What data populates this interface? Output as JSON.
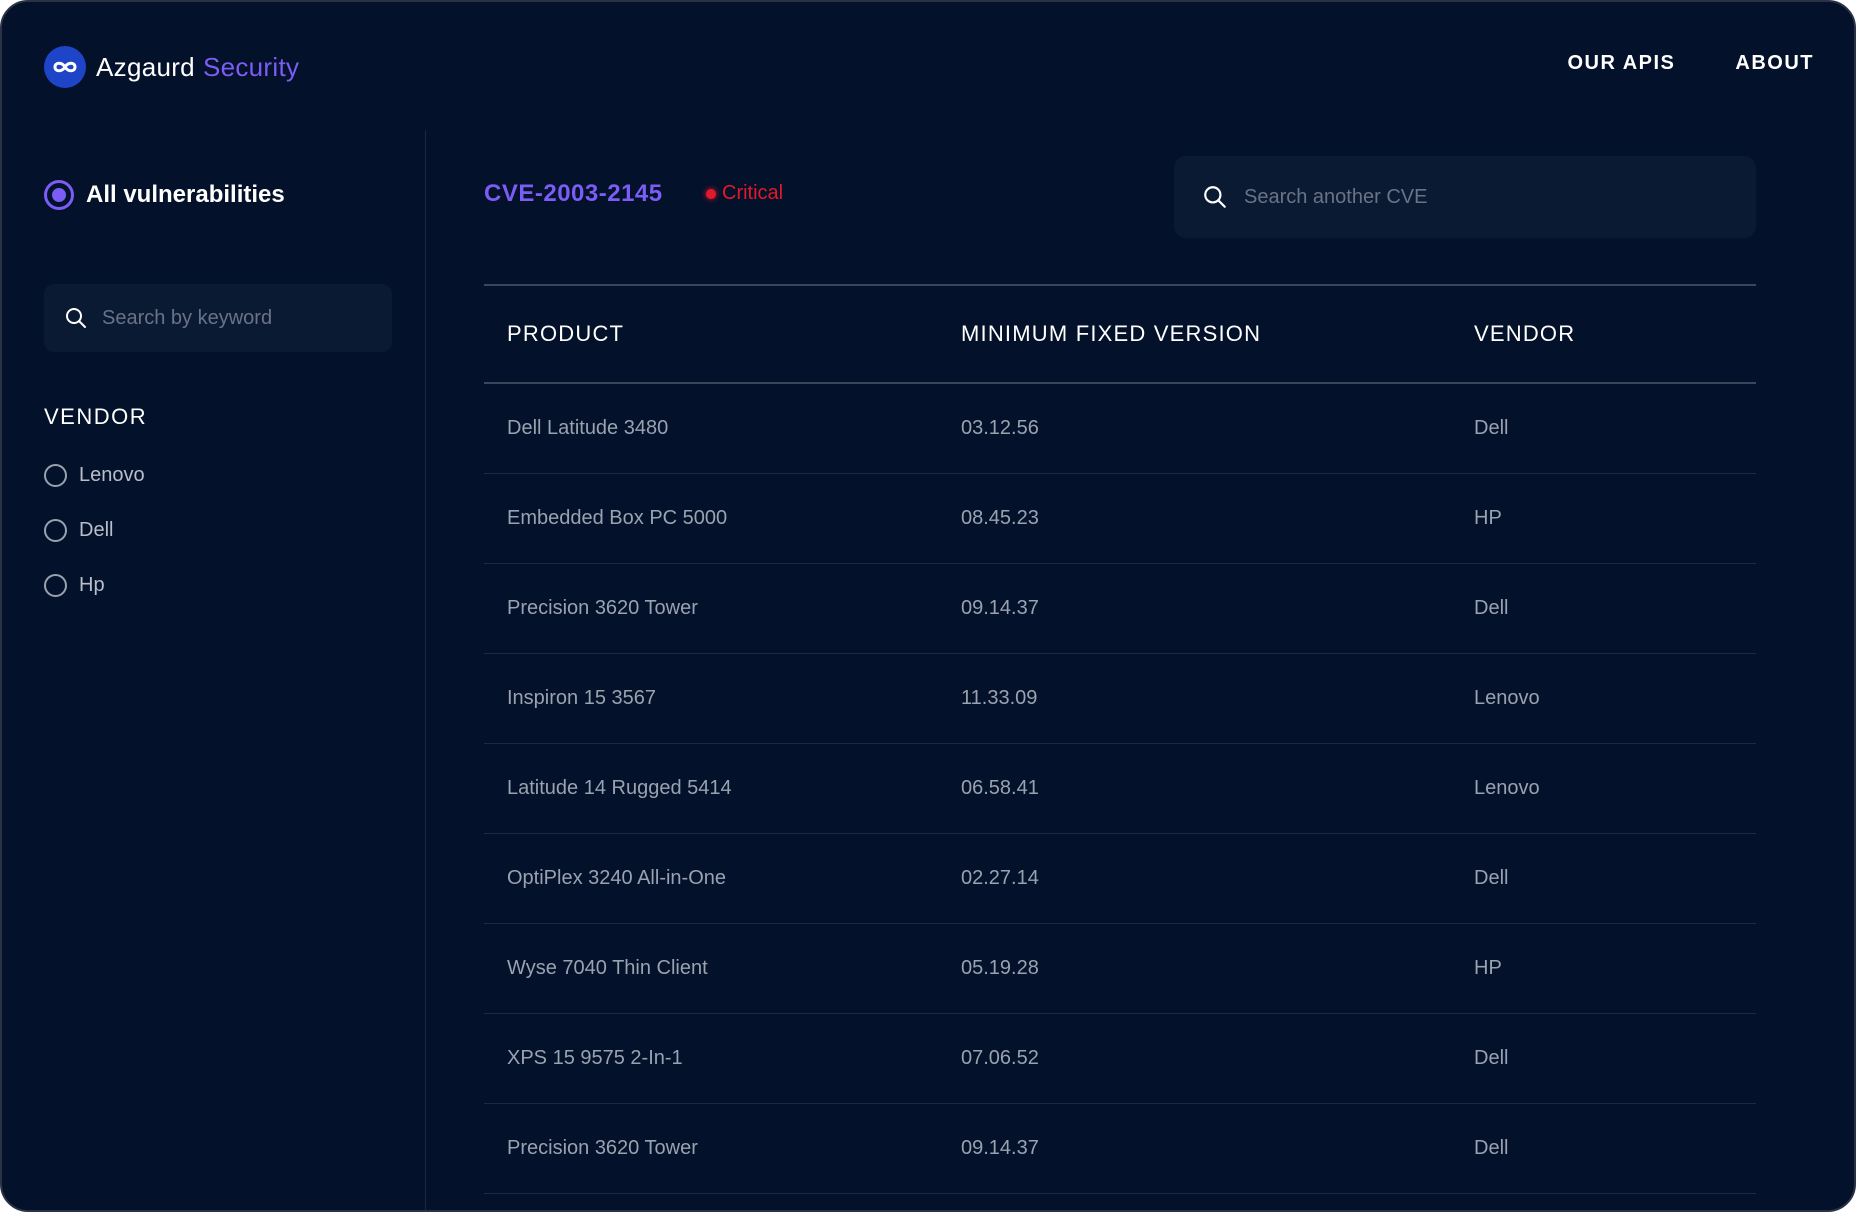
{
  "header": {
    "brand": "Azgaurd",
    "brand_accent": "Security",
    "nav": [
      "OUR APIS",
      "ABOUT"
    ]
  },
  "sidebar": {
    "all_label": "All vulnerabilities",
    "keyword_placeholder": "Search by keyword",
    "vendor_title": "VENDOR",
    "vendors": [
      "Lenovo",
      "Dell",
      "Hp"
    ]
  },
  "main": {
    "cve_id": "CVE-2003-2145",
    "severity": "Critical",
    "search_placeholder": "Search another CVE",
    "columns": [
      "PRODUCT",
      "MINIMUM FIXED VERSION",
      "VENDOR"
    ],
    "rows": [
      [
        "Dell Latitude 3480",
        "03.12.56",
        "Dell"
      ],
      [
        "Embedded Box PC 5000",
        "08.45.23",
        "HP"
      ],
      [
        "Precision 3620 Tower",
        "09.14.37",
        "Dell"
      ],
      [
        "Inspiron 15 3567",
        "11.33.09",
        "Lenovo"
      ],
      [
        "Latitude 14 Rugged 5414",
        "06.58.41",
        "Lenovo"
      ],
      [
        "OptiPlex 3240 All-in-One",
        "02.27.14",
        "Dell"
      ],
      [
        "Wyse 7040 Thin Client",
        "05.19.28",
        "HP"
      ],
      [
        "XPS 15 9575 2-In-1",
        "07.06.52",
        "Dell"
      ],
      [
        "Precision 3620 Tower",
        "09.14.37",
        "Dell"
      ]
    ]
  },
  "colors": {
    "background": "#03112a",
    "accent": "#7b5cf5",
    "critical": "#e01a2b",
    "logo": "#1e44c8"
  },
  "icons": {
    "logo": "infinity-logo-icon",
    "search": "search-icon"
  }
}
